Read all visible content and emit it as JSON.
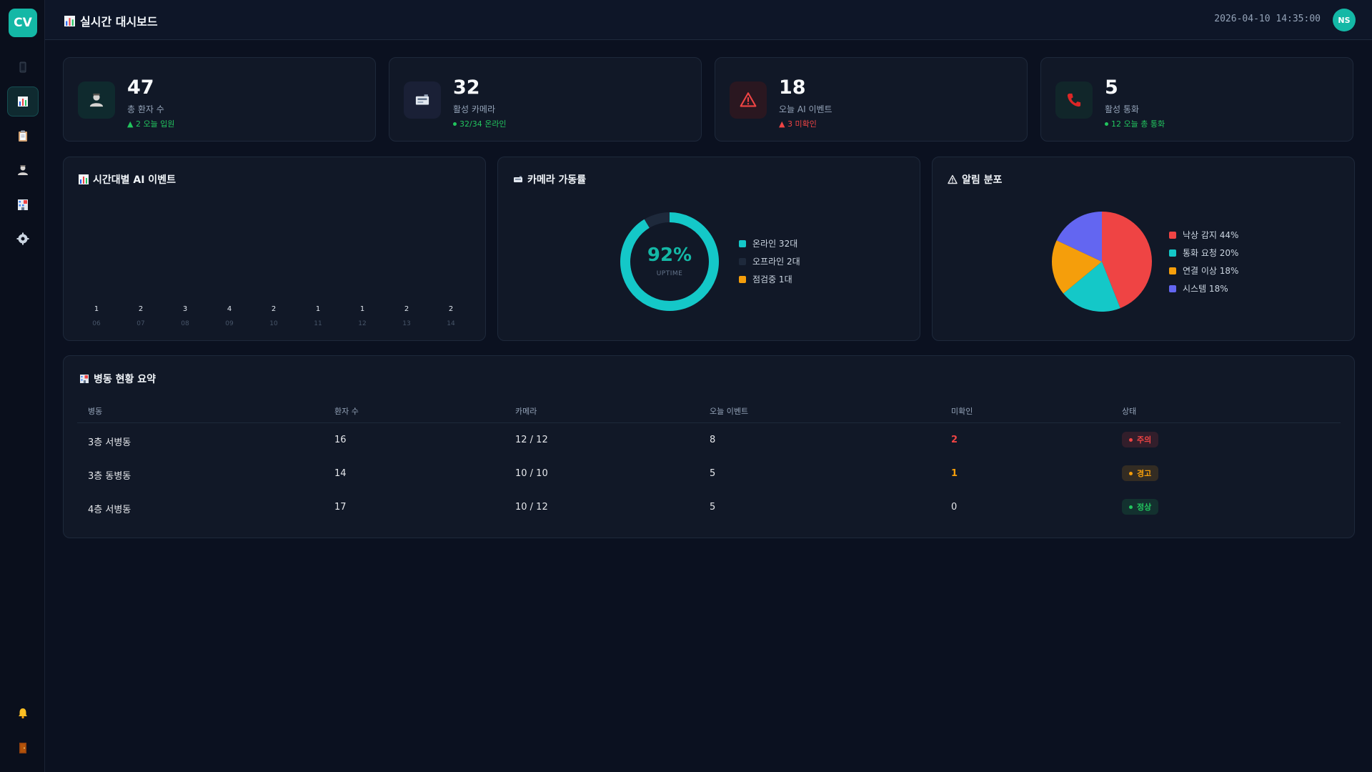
{
  "app": {
    "logo_text": "CV"
  },
  "header": {
    "title": "실시간 대시보드",
    "datetime": "2026-04-10 14:35:00",
    "user_initials": "NS"
  },
  "sidebar": {
    "items": [
      {
        "icon": "tablet-icon",
        "active": false
      },
      {
        "icon": "bar-chart-icon",
        "active": true
      },
      {
        "icon": "clipboard-icon",
        "active": false
      },
      {
        "icon": "patient-icon",
        "active": false
      },
      {
        "icon": "hospital-icon",
        "active": false
      },
      {
        "icon": "gear-icon",
        "active": false
      }
    ],
    "bottom_items": [
      {
        "icon": "bell-icon"
      },
      {
        "icon": "door-exit-icon"
      }
    ]
  },
  "stats": [
    {
      "value": "47",
      "label": "총 환자 수",
      "sub": "▲ 2 오늘 입원",
      "tone": "green",
      "icon": "patient-icon"
    },
    {
      "value": "32",
      "label": "활성 카메라",
      "sub": "32/34 온라인",
      "tone": "green",
      "icon": "camera-icon"
    },
    {
      "value": "18",
      "label": "오늘 AI 이벤트",
      "sub": "▲ 3 미확인",
      "tone": "red",
      "icon": "warning-icon"
    },
    {
      "value": "5",
      "label": "활성 통화",
      "sub": "12 오늘 총 통화",
      "tone": "green",
      "icon": "phone-icon"
    }
  ],
  "panels": {
    "events_title": "시간대별 AI 이벤트",
    "camera_title": "카메라 가동률",
    "alert_title": "알림 분포"
  },
  "chart_data": [
    {
      "type": "bar",
      "title": "시간대별 AI 이벤트",
      "categories": [
        "06",
        "07",
        "08",
        "09",
        "10",
        "11",
        "12",
        "13",
        "14"
      ],
      "values": [
        1,
        2,
        3,
        4,
        2,
        1,
        1,
        2,
        2
      ]
    },
    {
      "type": "pie",
      "title": "카메라 가동률",
      "center_value": "92%",
      "center_label": "UPTIME",
      "series": [
        {
          "name": "온라인 32대",
          "value": 32,
          "color": "#14c8c8"
        },
        {
          "name": "오프라인 2대",
          "value": 2,
          "color": "#1e293b"
        },
        {
          "name": "점검중 1대",
          "value": 1,
          "color": "#f59e0b"
        }
      ]
    },
    {
      "type": "pie",
      "title": "알림 분포",
      "series": [
        {
          "name": "낙상 감지 44%",
          "value": 44,
          "color": "#ef4444"
        },
        {
          "name": "통화 요청 20%",
          "value": 20,
          "color": "#14c8c8"
        },
        {
          "name": "연결 이상 18%",
          "value": 18,
          "color": "#f59e0b"
        },
        {
          "name": "시스템 18%",
          "value": 18,
          "color": "#6366f1"
        }
      ]
    }
  ],
  "table": {
    "title": "병동 현황 요약",
    "headers": [
      "병동",
      "환자 수",
      "카메라",
      "오늘 이벤트",
      "미확인",
      "상태"
    ],
    "rows": [
      {
        "ward": "3층 서병동",
        "patients": "16",
        "cameras": "12 / 12",
        "events": "8",
        "unconfirmed": "2",
        "status": "주의",
        "status_color": "#ef4444"
      },
      {
        "ward": "3층 동병동",
        "patients": "14",
        "cameras": "10 / 10",
        "events": "5",
        "unconfirmed": "1",
        "status": "경고",
        "status_color": "#f59e0b"
      },
      {
        "ward": "4층 서병동",
        "patients": "17",
        "cameras": "10 / 12",
        "events": "5",
        "unconfirmed": "0",
        "status": "정상",
        "status_color": "#22c55e"
      }
    ]
  }
}
